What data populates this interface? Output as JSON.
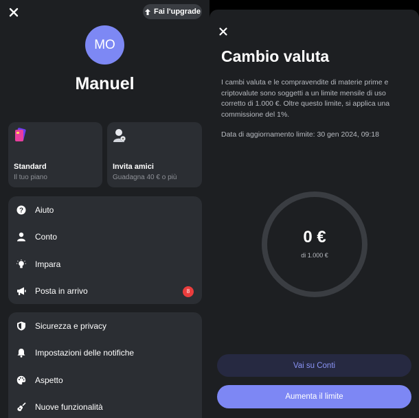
{
  "profile": {
    "upgrade_label": "Fai l'upgrade",
    "avatar_initials": "MO",
    "name": "Manuel"
  },
  "cards": {
    "standard": {
      "title": "Standard",
      "subtitle": "Il tuo piano"
    },
    "invite": {
      "title": "Invita amici",
      "subtitle": "Guadagna 40 € o più"
    }
  },
  "menu_primary": [
    {
      "label": "Aiuto",
      "icon": "help-icon"
    },
    {
      "label": "Conto",
      "icon": "person-icon"
    },
    {
      "label": "Impara",
      "icon": "lightbulb-icon"
    },
    {
      "label": "Posta in arrivo",
      "icon": "megaphone-icon",
      "badge": "8"
    }
  ],
  "menu_secondary": [
    {
      "label": "Sicurezza e privacy",
      "icon": "shield-icon"
    },
    {
      "label": "Impostazioni delle notifiche",
      "icon": "bell-icon"
    },
    {
      "label": "Aspetto",
      "icon": "palette-icon"
    },
    {
      "label": "Nuove funzionalità",
      "icon": "guitar-icon"
    }
  ],
  "exchange": {
    "title": "Cambio valuta",
    "description": "I cambi valuta e le compravendite di materie prime e criptovalute sono soggetti a un limite mensile di uso corretto di 1.000 €. Oltre questo limite, si applica una commissione del 1%.",
    "update_text": "Data di aggiornamento limite: 30 gen 2024, 09:18",
    "used_amount": "0 €",
    "limit_text": "di 1.000 €",
    "usage_fraction": 0,
    "btn_accounts": "Vai su Conti",
    "btn_increase": "Aumenta il limite"
  },
  "colors": {
    "accent": "#7d87f4",
    "badge": "#ea3d3d",
    "panel": "#1d1f22",
    "card": "#2b2e33"
  }
}
